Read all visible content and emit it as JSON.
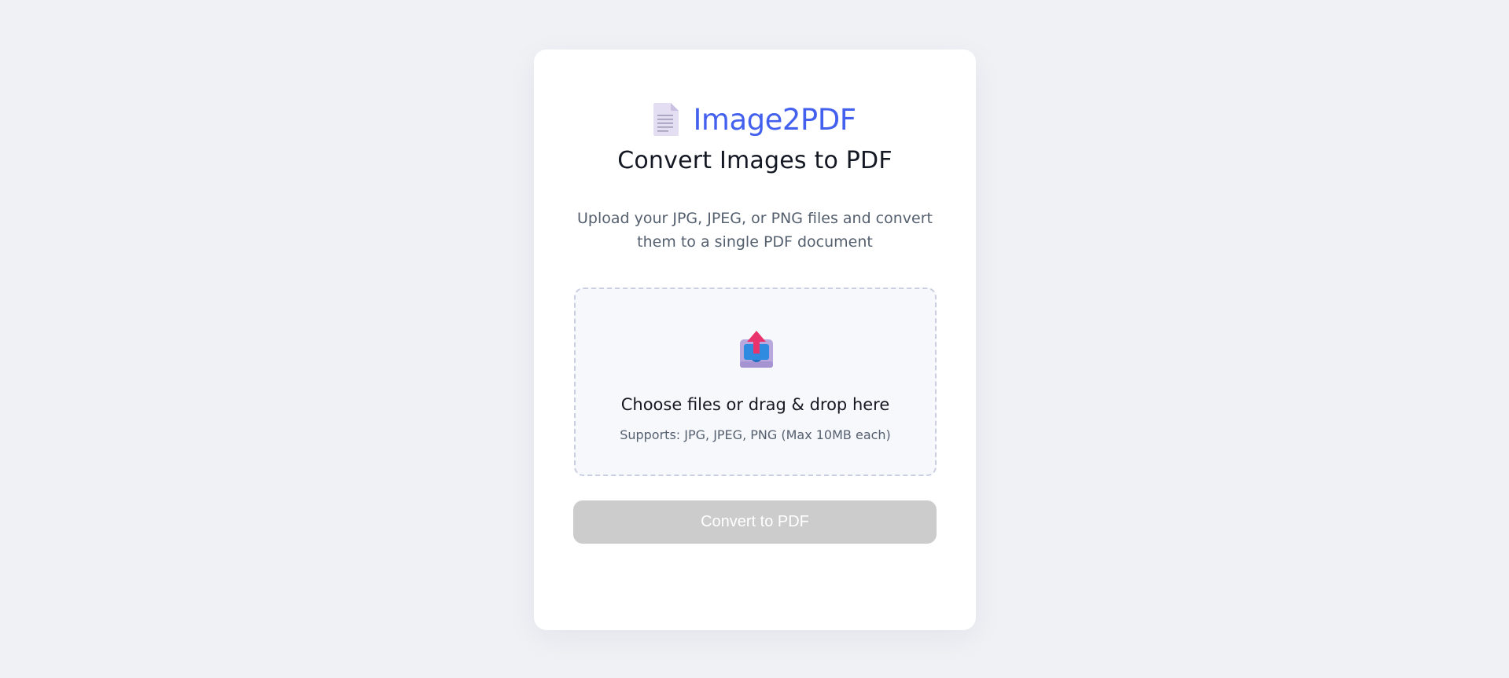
{
  "brand": {
    "name": "Image2PDF",
    "icon": "document-icon",
    "color": "#4361ee"
  },
  "headline": "Convert Images to PDF",
  "subtitle": "Upload your JPG, JPEG, or PNG files and convert them to a single PDF document",
  "dropzone": {
    "icon": "upload-icon",
    "title": "Choose files or drag & drop here",
    "hint": "Supports: JPG, JPEG, PNG (Max 10MB each)"
  },
  "convert_button": {
    "label": "Convert to PDF",
    "state": "disabled",
    "color": "#cccccc"
  }
}
